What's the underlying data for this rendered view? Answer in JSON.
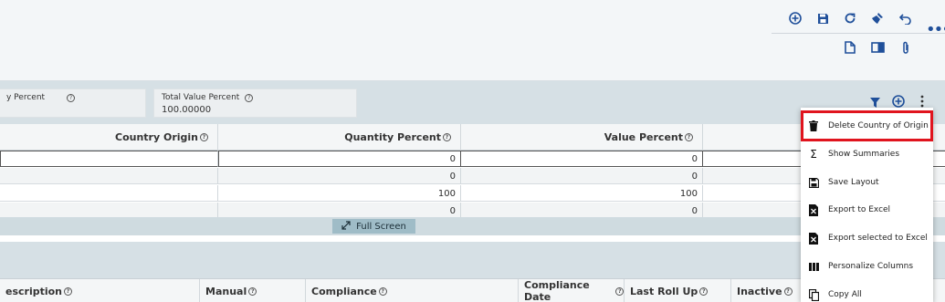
{
  "toolbar": {
    "row1": [
      "add-circle-icon",
      "save-icon",
      "refresh-icon",
      "clear-brush-icon",
      "undo-icon"
    ],
    "row2": [
      "document-icon",
      "panel-icon",
      "attachment-icon"
    ],
    "more": "•••"
  },
  "summary": {
    "qty_label": "y Percent",
    "total_value_label": "Total Value Percent",
    "total_value": "100.00000"
  },
  "grid": {
    "columns": [
      "Country Origin",
      "Quantity Percent",
      "Value Percent"
    ],
    "rows": [
      {
        "qty": "0",
        "value": "0"
      },
      {
        "qty": "0",
        "value": "0"
      },
      {
        "qty": "100",
        "value": "100"
      },
      {
        "qty": "0",
        "value": "0"
      }
    ],
    "fullscreen_label": "Full Screen"
  },
  "grid2": {
    "columns": [
      "escription",
      "Manual",
      "Compliance",
      "Compliance Date",
      "Last Roll Up",
      "Inactive"
    ]
  },
  "menu": {
    "items": [
      {
        "label": "Delete Country of Origin",
        "icon": "trash-icon"
      },
      {
        "label": "Show Summaries",
        "icon": "sigma-icon"
      },
      {
        "label": "Save Layout",
        "icon": "save-layout-icon"
      },
      {
        "label": "Export to Excel",
        "icon": "excel-icon"
      },
      {
        "label": "Export selected to Excel",
        "icon": "excel-selected-icon"
      },
      {
        "label": "Personalize Columns",
        "icon": "columns-icon"
      },
      {
        "label": "Copy All",
        "icon": "copy-icon"
      }
    ]
  },
  "colors": {
    "accent": "#1f4f9a",
    "highlight": "#e0141e"
  }
}
